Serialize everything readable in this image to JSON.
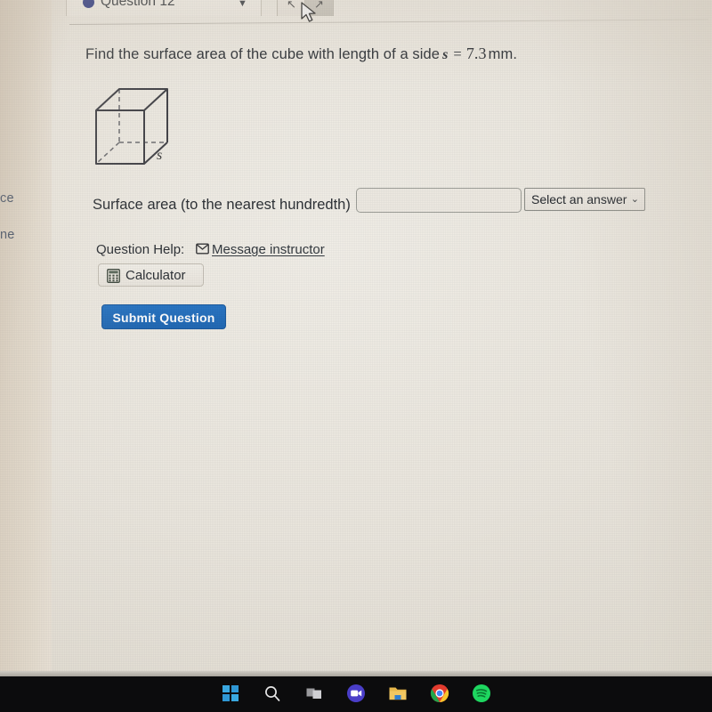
{
  "tabbar": {
    "question_tab_label": "Question 12",
    "bullet_color": "#232f7c",
    "caret": "▼",
    "prev_glyph": "↖",
    "next_glyph": "↗"
  },
  "sidebar": {
    "fragments": [
      {
        "text": "ce"
      },
      {
        "text": "ne"
      }
    ]
  },
  "question": {
    "prefix": "Find the surface area of the cube with length of a side",
    "variable": "s",
    "equals": "=",
    "value": "7.3",
    "unit": "mm.",
    "figure_label": "s"
  },
  "answer": {
    "label": "Surface area (to the nearest hundredth)",
    "input_value": "",
    "input_placeholder": "",
    "select_label": "Select an answer",
    "select_caret": "⌄"
  },
  "help": {
    "label": "Question Help:",
    "mail_icon": "envelope-icon",
    "message_instructor": "Message instructor",
    "calculator_label": "Calculator",
    "calculator_icon": "calculator-icon"
  },
  "submit": {
    "label": "Submit Question",
    "color": "#2269b4"
  },
  "taskbar": {
    "items": [
      {
        "name": "start-button",
        "icon": "windows-logo-icon",
        "color": "#3aa8e0"
      },
      {
        "name": "search-button",
        "icon": "search-icon",
        "color": "#e8e8e8"
      },
      {
        "name": "task-view-button",
        "icon": "task-view-icon",
        "color": "#8f8f8f"
      },
      {
        "name": "zoom-app",
        "icon": "video-camera-icon",
        "color": "#4a3ec8"
      },
      {
        "name": "file-explorer",
        "icon": "folder-icon",
        "color": "#e8b84b"
      },
      {
        "name": "chrome-browser",
        "icon": "chrome-icon",
        "color": "#4285f4"
      },
      {
        "name": "spotify-app",
        "icon": "spotify-icon",
        "color": "#1ed760"
      }
    ]
  }
}
